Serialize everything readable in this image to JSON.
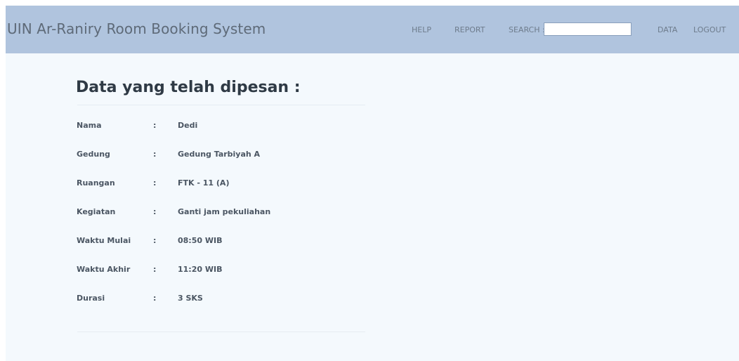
{
  "navbar": {
    "brand": "UIN Ar-Raniry Room Booking System",
    "help": "HELP",
    "report": "REPORT",
    "search_label": "SEARCH :",
    "search_value": "",
    "data": "DATA",
    "logout": "LOGOUT"
  },
  "main": {
    "title": "Data yang telah dipesan :",
    "separator": ":",
    "rows": [
      {
        "label": "Nama",
        "value": "Dedi"
      },
      {
        "label": "Gedung",
        "value": "Gedung Tarbiyah A"
      },
      {
        "label": "Ruangan",
        "value": "FTK - 11 (A)"
      },
      {
        "label": "Kegiatan",
        "value": "Ganti jam pekuliahan"
      },
      {
        "label": "Waktu Mulai",
        "value": "08:50 WIB"
      },
      {
        "label": "Waktu Akhir",
        "value": "11:20 WIB"
      },
      {
        "label": "Durasi",
        "value": "3 SKS"
      }
    ]
  },
  "colors": {
    "navbar_bg": "#b0c4de",
    "page_bg": "#f4f9fd",
    "title_text": "#2f3a45",
    "body_text": "#4b5663"
  }
}
